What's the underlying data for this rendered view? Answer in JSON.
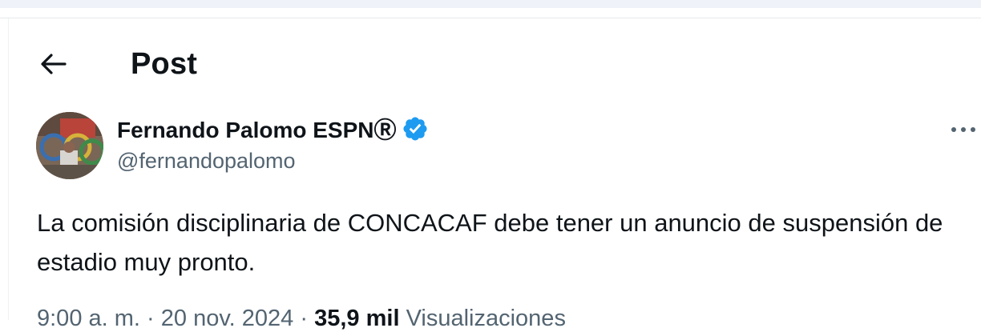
{
  "header": {
    "title": "Post",
    "back_icon": "arrow-left-icon"
  },
  "author": {
    "name": "Fernando Palomo ESPNⓇ",
    "handle": "@fernandopalomo",
    "verified": true,
    "verified_color": "#1d9bf0"
  },
  "post": {
    "text": "La comisión disciplinaria de CONCACAF debe tener un anuncio de suspensión de estadio muy pronto.",
    "time": "9:00 a. m.",
    "date": "20 nov. 2024",
    "separator": "·",
    "views_count": "35,9 mil",
    "views_label": "Visualizaciones"
  },
  "more_icon": "more-horizontal-icon",
  "colors": {
    "text_primary": "#0f1419",
    "text_secondary": "#536471",
    "verified_blue": "#1d9bf0"
  }
}
